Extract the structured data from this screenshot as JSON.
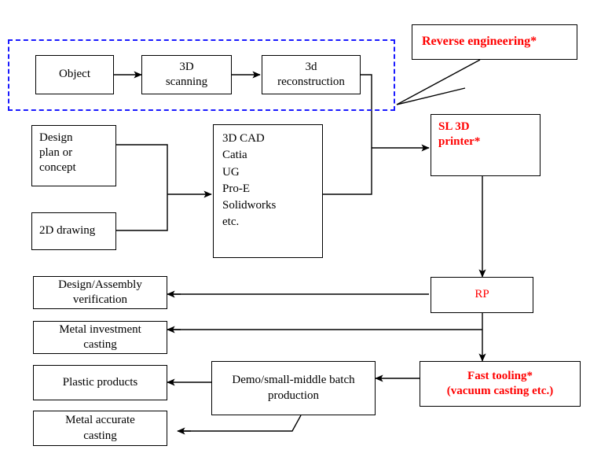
{
  "diagram": {
    "title": "Rapid prototyping / reverse engineering process flowchart",
    "colors": {
      "accent_red": "#ff0000",
      "group_border_blue": "#1a1aff",
      "line_black": "#000000",
      "background": "#ffffff"
    },
    "groups": [
      {
        "id": "reverse-engineering-group",
        "label": ""
      }
    ],
    "nodes": {
      "object": "Object",
      "scanning_3d": "3D\nscanning",
      "reconstruction_3d": "3d\nreconstruction",
      "reverse_engineering": "Reverse engineering*",
      "design_plan": "Design\nplan or\nconcept",
      "drawing_2d": "2D drawing",
      "cad_list": "3D CAD\nCatia\nUG\nPro-E\nSolidworks\netc.",
      "sl_3d_printer": "SL 3D\nprinter*",
      "rp": "RP",
      "design_verification": "Design/Assembly\nverification",
      "metal_investment_casting": "Metal investment\ncasting",
      "plastic_products": "Plastic products",
      "metal_accurate_casting": "Metal accurate\ncasting",
      "demo_production": "Demo/small-middle batch\nproduction",
      "fast_tooling": "Fast tooling*\n(vacuum casting etc.)"
    },
    "cad_items": [
      "3D CAD",
      "Catia",
      "UG",
      "Pro-E",
      "Solidworks",
      "etc."
    ],
    "edges": [
      {
        "from": "object",
        "to": "scanning_3d",
        "style": "arrow"
      },
      {
        "from": "scanning_3d",
        "to": "reconstruction_3d",
        "style": "arrow"
      },
      {
        "from": "reconstruction_3d",
        "to": "sl_3d_printer",
        "style": "arrow"
      },
      {
        "from": "design_plan",
        "to": "cad_list",
        "style": "arrow"
      },
      {
        "from": "drawing_2d",
        "to": "cad_list",
        "style": "arrow"
      },
      {
        "from": "cad_list",
        "to": "sl_3d_printer",
        "style": "arrow"
      },
      {
        "from": "sl_3d_printer",
        "to": "rp",
        "style": "arrow"
      },
      {
        "from": "rp",
        "to": "design_verification",
        "style": "arrow"
      },
      {
        "from": "rp",
        "to": "metal_investment_casting",
        "style": "arrow"
      },
      {
        "from": "rp",
        "to": "fast_tooling",
        "style": "arrow"
      },
      {
        "from": "fast_tooling",
        "to": "demo_production",
        "style": "arrow"
      },
      {
        "from": "demo_production",
        "to": "plastic_products",
        "style": "arrow"
      },
      {
        "from": "demo_production",
        "to": "metal_accurate_casting",
        "style": "arrow"
      },
      {
        "from": "reverse_engineering",
        "to": "reverse-engineering-group",
        "style": "callout"
      }
    ]
  }
}
